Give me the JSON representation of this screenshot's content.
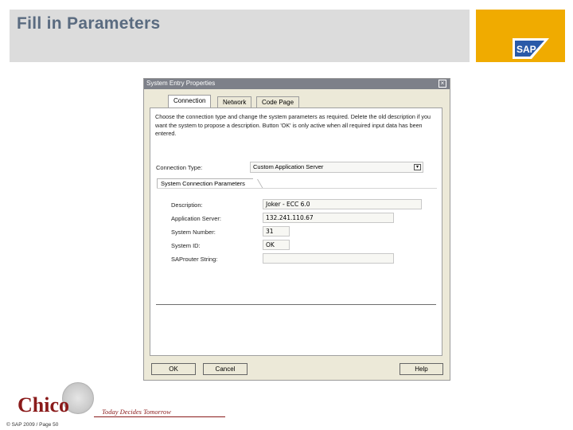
{
  "slide": {
    "title": "Fill in Parameters",
    "footer": "© SAP 2009 / Page 50",
    "sap_logo_text": "SAP",
    "sap_box_color": "#f0ab00"
  },
  "dialog": {
    "title": "System Entry Properties",
    "close_icon": "close-icon",
    "tabs": [
      "Connection",
      "Network",
      "Code Page"
    ],
    "active_tab": "Connection",
    "description": "Choose the connection type and change the system parameters as required. Delete the old description if you want the system to propose a description. Button 'OK' is only active when all required input data has been entered.",
    "connection_type": {
      "label": "Connection Type:",
      "value": "Custom Application Server"
    },
    "group_label": "System Connection Parameters",
    "fields": [
      {
        "label": "Description:",
        "value": "Joker - ECC 6.0"
      },
      {
        "label": "Application Server:",
        "value": "132.241.110.67"
      },
      {
        "label": "System Number:",
        "value": "31"
      },
      {
        "label": "System ID:",
        "value": "OK"
      },
      {
        "label": "SAProuter String:",
        "value": ""
      }
    ],
    "buttons": {
      "ok": "OK",
      "cancel": "Cancel",
      "help": "Help"
    }
  },
  "branding": {
    "logo_text": "Chico",
    "tagline": "Today Decides Tomorrow"
  }
}
